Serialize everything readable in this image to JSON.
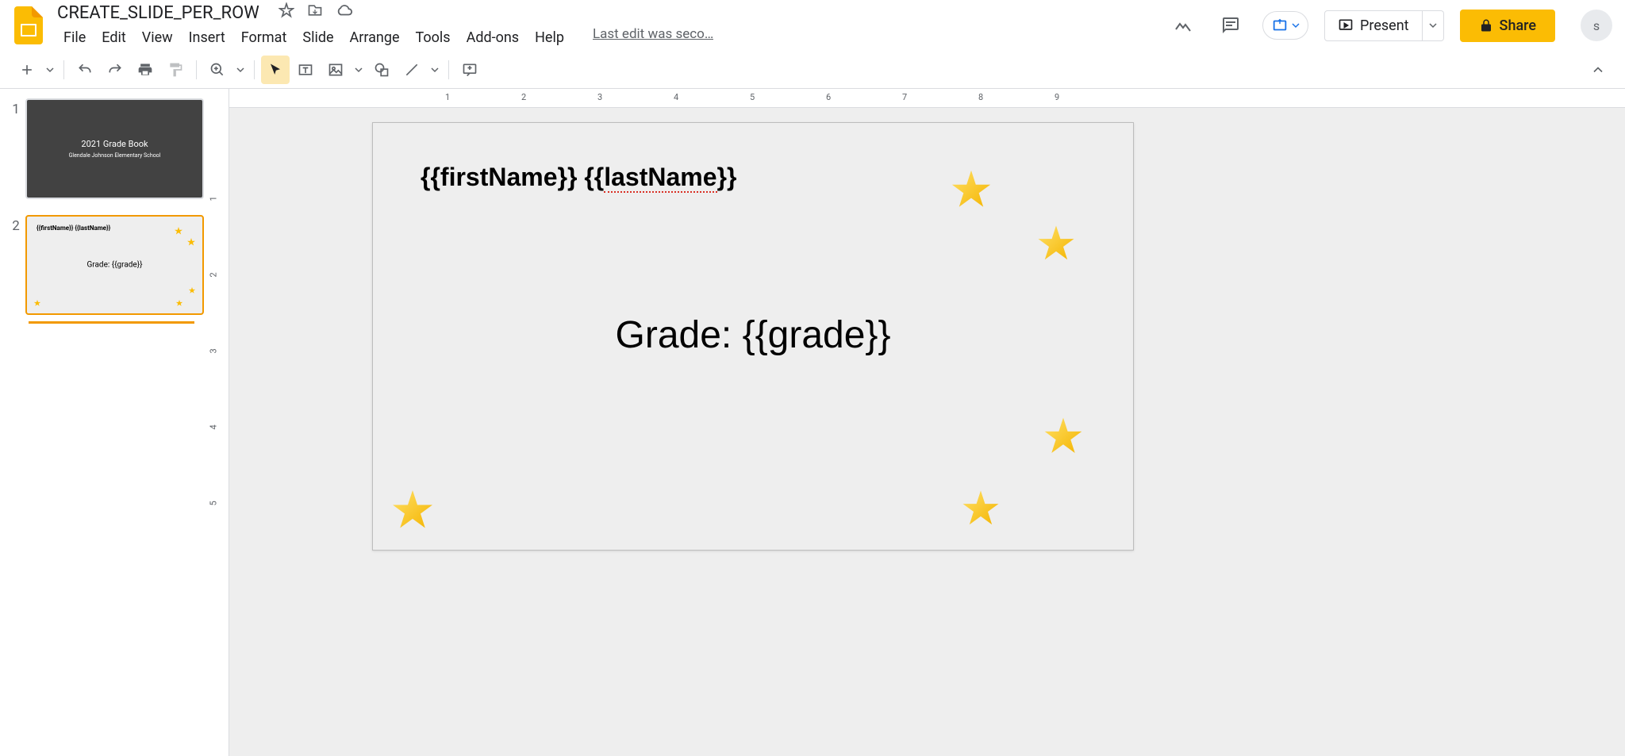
{
  "doc": {
    "title": "CREATE_SLIDE_PER_ROW",
    "last_edit": "Last edit was seco…"
  },
  "menu": {
    "file": "File",
    "edit": "Edit",
    "view": "View",
    "insert": "Insert",
    "format": "Format",
    "slide": "Slide",
    "arrange": "Arrange",
    "tools": "Tools",
    "addons": "Add-ons",
    "help": "Help"
  },
  "buttons": {
    "present": "Present",
    "share": "Share"
  },
  "avatar": "s",
  "thumbnails": [
    {
      "num": "1",
      "title": "2021 Grade Book",
      "subtitle": "Glendale Johnson Elementary School"
    },
    {
      "num": "2",
      "name": "{{firstName}} {{lastName}}",
      "grade": "Grade: {{grade}}"
    }
  ],
  "slide": {
    "name_first": "{{firstName}} ",
    "name_last_pre": "{{",
    "name_last_err": "lastName",
    "name_last_post": "}}",
    "grade": "Grade: {{grade}}"
  },
  "ruler_h": [
    "1",
    "2",
    "3",
    "4",
    "5",
    "6",
    "7",
    "8",
    "9"
  ],
  "ruler_v": [
    "1",
    "2",
    "3",
    "4",
    "5"
  ]
}
